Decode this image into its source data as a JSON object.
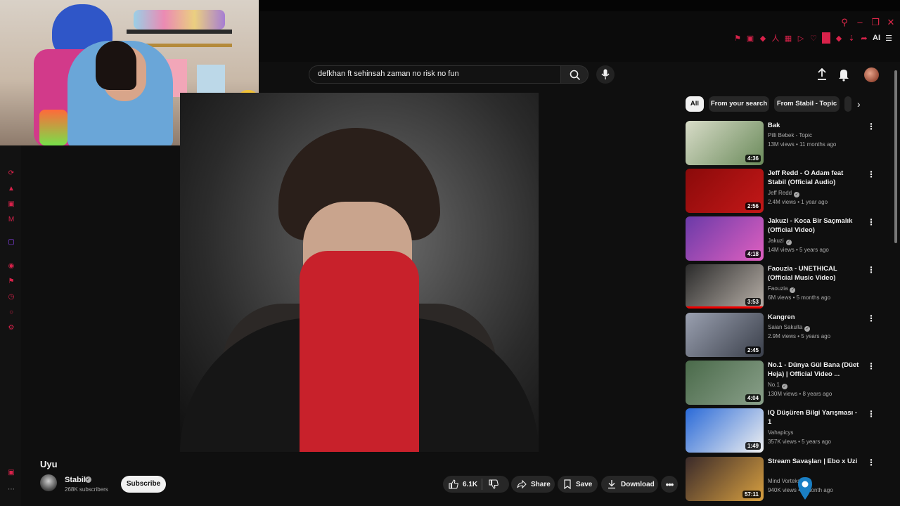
{
  "search": {
    "query": "defkhan ft sehinsah zaman no risk no fun"
  },
  "video": {
    "title": "Uyu",
    "channel": "Stabil",
    "subscribers": "268K subscribers",
    "subscribe_label": "Subscribe",
    "likes": "6.1K",
    "share_label": "Share",
    "save_label": "Save",
    "download_label": "Download"
  },
  "browser": {
    "ai_label": "AI"
  },
  "chips": [
    "All",
    "From your search",
    "From Stabil - Topic"
  ],
  "recommendations": [
    {
      "title": "Bak",
      "channel": "Pilli Bebek - Topic",
      "verified": false,
      "views": "13M views",
      "age": "11 months ago",
      "duration": "4:36",
      "thumb_colors": [
        "#d8dcc8",
        "#6a8a5a"
      ]
    },
    {
      "title": "Jeff Redd - O Adam feat Stabil (Official Audio)",
      "channel": "Jeff Redd",
      "verified": true,
      "views": "2.4M views",
      "age": "1 year ago",
      "duration": "2:56",
      "thumb_colors": [
        "#8a0a0a",
        "#c41818"
      ]
    },
    {
      "title": "Jakuzi - Koca Bir Saçmalık (Official Video)",
      "channel": "Jakuzi",
      "verified": true,
      "views": "14M views",
      "age": "5 years ago",
      "duration": "4:18",
      "thumb_colors": [
        "#6a3aa8",
        "#e060c0"
      ]
    },
    {
      "title": "Faouzia - UNETHICAL (Official Music Video)",
      "channel": "Faouzia",
      "verified": true,
      "views": "6M views",
      "age": "5 months ago",
      "duration": "3:53",
      "thumb_colors": [
        "#2a2a2a",
        "#b8b0a8"
      ],
      "watched": true
    },
    {
      "title": "Kangren",
      "channel": "Saian Sakulta",
      "verified": true,
      "views": "2.9M views",
      "age": "5 years ago",
      "duration": "2:45",
      "thumb_colors": [
        "#9aa0b0",
        "#3a3f4a"
      ]
    },
    {
      "title": "No.1 - Dünya Gül Bana (Düet Heja) | Official Video ...",
      "channel": "No.1",
      "verified": true,
      "views": "130M views",
      "age": "8 years ago",
      "duration": "4:04",
      "thumb_colors": [
        "#4a6a4a",
        "#8aa08a"
      ]
    },
    {
      "title": "IQ Düşüren Bilgi Yarışması - 1",
      "channel": "Vahapicys",
      "verified": false,
      "views": "357K views",
      "age": "5 years ago",
      "duration": "1:49",
      "thumb_colors": [
        "#2a6ad8",
        "#f0f0f0"
      ]
    },
    {
      "title": "Stream Savaşları | Ebo x Uzi",
      "channel": "Mind Vorteks",
      "verified": true,
      "views": "940K views",
      "age": "1 month ago",
      "duration": "57:11",
      "thumb_colors": [
        "#3a2a2a",
        "#d8a040"
      ]
    }
  ]
}
